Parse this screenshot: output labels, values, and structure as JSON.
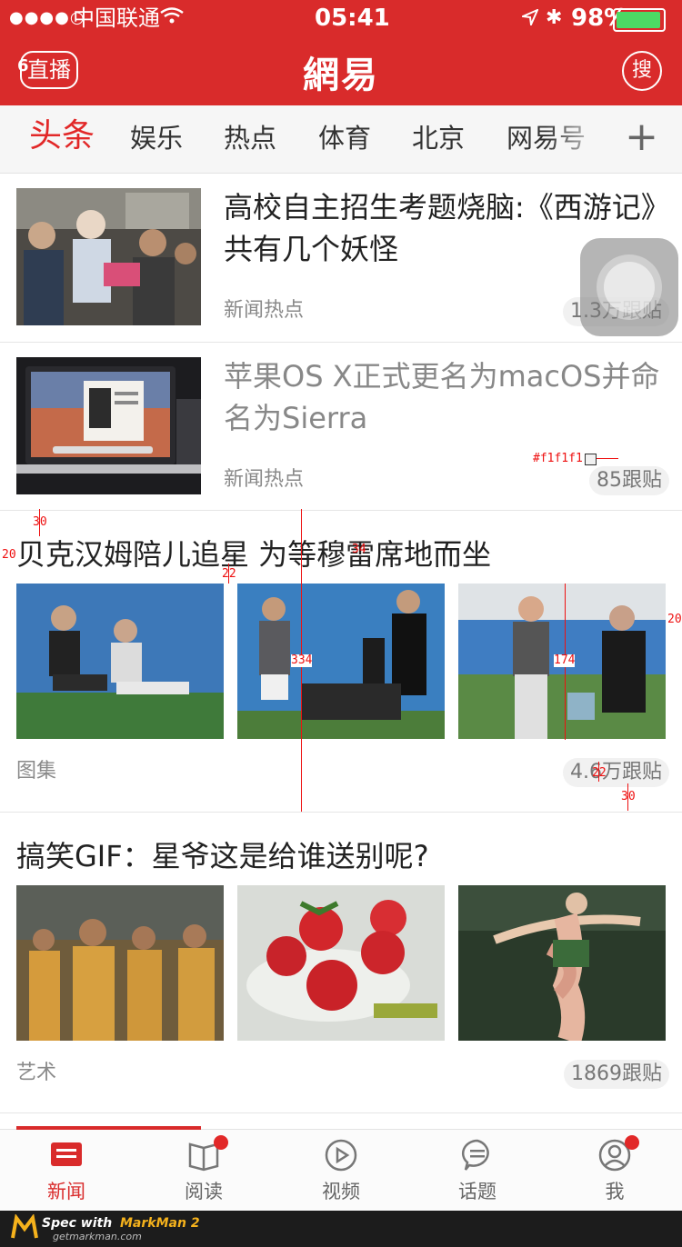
{
  "status": {
    "signal": "●●●●○",
    "carrier": "中国联通",
    "time": "05:41",
    "battery_pct": "98%"
  },
  "header": {
    "live_label": "直播",
    "live_count": "6",
    "logo": "網易",
    "search_label": "搜"
  },
  "tabs": {
    "items": [
      "头条",
      "娱乐",
      "热点",
      "体育",
      "北京",
      "网易号"
    ],
    "add_label": "+"
  },
  "news": [
    {
      "title": "高校自主招生考题烧脑:《西游记》共有几个妖怪",
      "source": "新闻热点",
      "comments": "1.3万跟贴"
    },
    {
      "title": "苹果OS X正式更名为macOS并命名为Sierra",
      "source": "新闻热点",
      "comments": "85跟贴"
    }
  ],
  "photo_sets": [
    {
      "title": "贝克汉姆陪儿追星 为等穆雷席地而坐",
      "source": "图集",
      "comments": "4.6万跟贴"
    },
    {
      "title": "搞笑GIF：星爷这是给谁送别呢?",
      "source": "艺术",
      "comments": "1869跟贴"
    }
  ],
  "spec": {
    "color_label": "#f1f1f1",
    "m_top": "30",
    "m_left": "20",
    "m_gap": "22",
    "m_mid": "34",
    "m_height": "334",
    "m_img": "174",
    "m_right": "20",
    "m_gap2": "22",
    "m_bottom": "30"
  },
  "bottom_nav": {
    "items": [
      "新闻",
      "阅读",
      "视频",
      "话题",
      "我"
    ]
  },
  "footer": {
    "brand_prefix": "Spec with ",
    "brand": "MarkMan 2",
    "url": "getmarkman.com"
  },
  "colors": {
    "brand": "#d92b2b",
    "accent_tab": "#e22828",
    "pill_bg": "#f1f1f1"
  }
}
